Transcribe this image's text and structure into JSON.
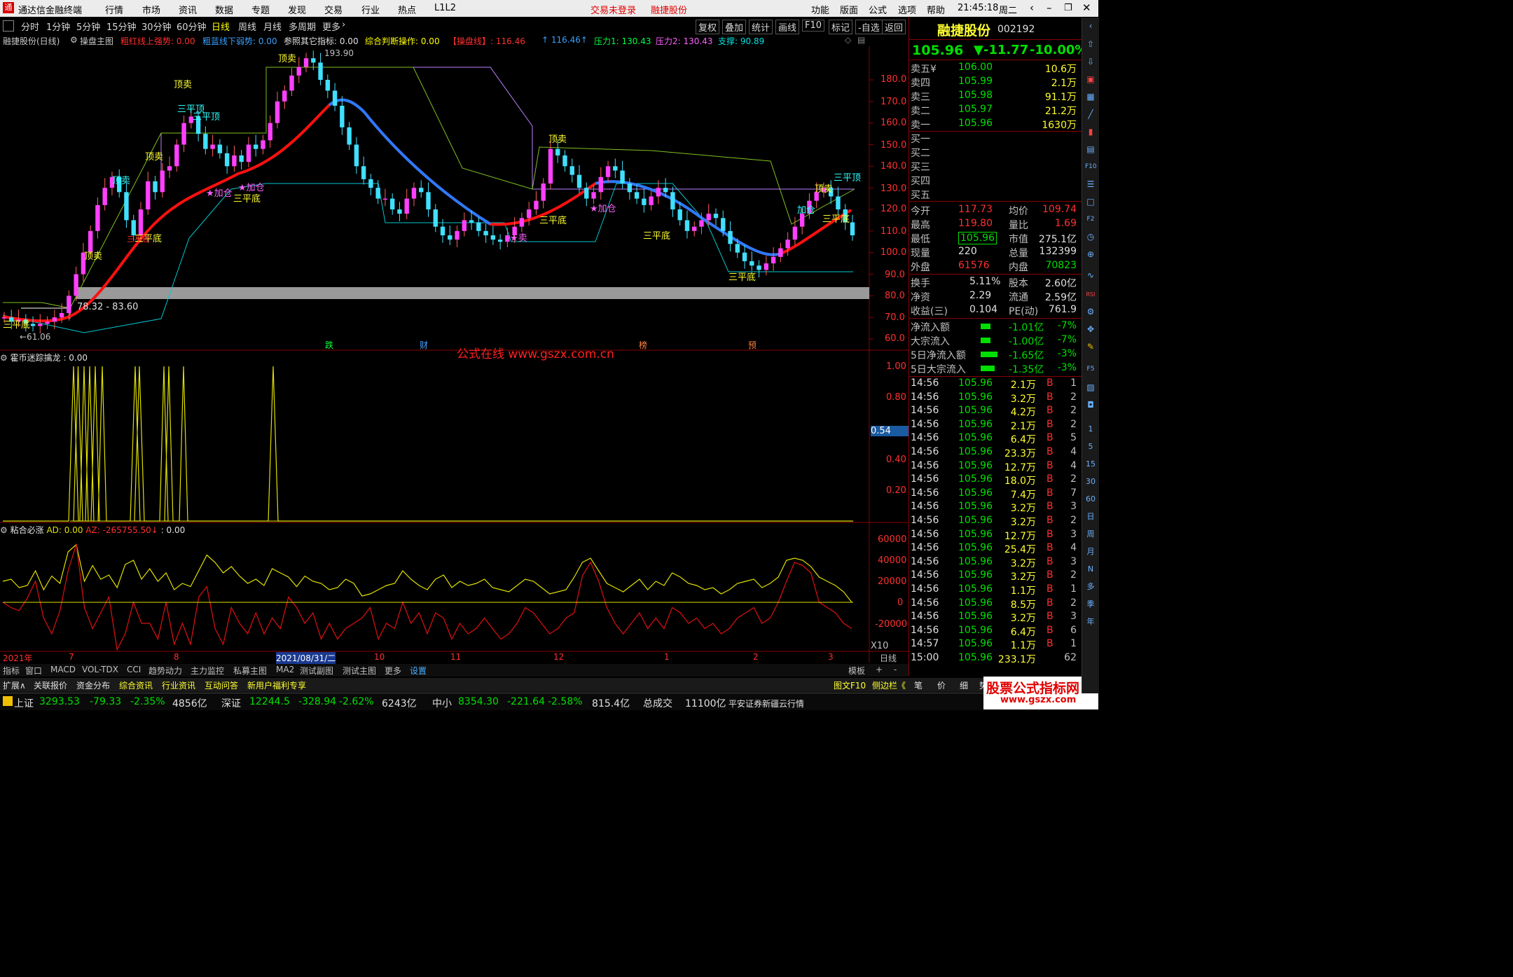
{
  "menubar": {
    "title": "通达信金融终端",
    "items": [
      "行情",
      "市场",
      "资讯",
      "数据",
      "专题",
      "发现",
      "交易",
      "行业",
      "热点",
      "L1L2"
    ],
    "login": "交易未登录",
    "stock": "融捷股份",
    "right": [
      "功能",
      "版面",
      "公式",
      "选项",
      "帮助"
    ],
    "time": "21:45:18",
    "weekday": "周二"
  },
  "toolbar": {
    "periods": [
      "分时",
      "1分钟",
      "5分钟",
      "15分钟",
      "30分钟",
      "60分钟",
      "日线",
      "周线",
      "月线",
      "多周期",
      "更多"
    ],
    "right": [
      "复权",
      "叠加",
      "统计",
      "画线",
      "F10",
      "标记",
      "-自选",
      "返回"
    ]
  },
  "infobar": {
    "name": "融捷股份(日线)",
    "formula": "操盘主图",
    "t1": "粗红线上强势: 0.00",
    "t2": "粗蓝线下弱势: 0.00",
    "t3": "参照其它指标: 0.00",
    "t4": "综合判断操作: 0.00",
    "t5": "【操盘线】: 116.46",
    "t6": "↑ 116.46↑",
    "t7": "压力1: 130.43",
    "t8": "压力2: 130.43",
    "t9": "支撑: 90.89"
  },
  "chart_labels": {
    "high": "193.90",
    "low": "←61.06",
    "zone": "78.32 - 83.60",
    "events": [
      "跌",
      "财",
      "榜",
      "预"
    ],
    "watermark": "公式在线  www.gszx.com.cn",
    "signals": [
      "顶卖",
      "顶卖",
      "三平顶",
      "三平顶",
      "顶卖",
      "顶卖",
      "顶卖",
      "三平底",
      "三平底",
      "★加仓",
      "★加仓",
      "三平底",
      "三平底",
      "三平底",
      "顶卖",
      "顶卖",
      "三平顶",
      "三平底",
      "★加仓",
      "★卖",
      "加仓",
      "三平底",
      "三平底"
    ]
  },
  "indicator1": {
    "name": "霍币迷踪擒龙",
    "value": ": 0.00",
    "current": "0.54"
  },
  "indicator2": {
    "name": "粘合必涨",
    "ad": "AD: 0.00",
    "az": "AZ: -265755.50↓",
    "tail": ": 0.00",
    "x10": "X10"
  },
  "date_axis": [
    "2021年",
    "7",
    "8",
    "2021/08/31/二",
    "10",
    "11",
    "12",
    "1",
    "2",
    "3"
  ],
  "date_axis_right": "日线",
  "price_axis": [
    "180.0",
    "170.0",
    "160.0",
    "150.0",
    "140.0",
    "130.0",
    "120.0",
    "110.0",
    "100.0",
    "90.0",
    "80.0",
    "70.0",
    "60.0"
  ],
  "ind1_axis": [
    "1.00",
    "0.80",
    "0.40",
    "0.20"
  ],
  "ind2_axis": [
    "60000",
    "40000",
    "20000",
    "0",
    "-20000"
  ],
  "bottombar": [
    "指标",
    "窗口",
    "MACD",
    "VOL-TDX",
    "CCI",
    "趋势动力",
    "主力监控",
    "私募主图",
    "MA2",
    "测试副图",
    "测试主图",
    "更多",
    "设置",
    "模板",
    "+",
    "-"
  ],
  "tabs2": [
    "扩展∧",
    "关联报价",
    "资金分布",
    "综合资讯",
    "行业资讯",
    "互动问答",
    "新用户福利专享"
  ],
  "tabs2_right": [
    "图文F10",
    "侧边栏《",
    "笔",
    "价",
    "细",
    "势"
  ],
  "quote": {
    "name": "融捷股份",
    "code": "002192",
    "price": "105.96",
    "change": "▼-11.77",
    "pct": "-10.00%",
    "sell": [
      {
        "label": "卖五¥",
        "price": "106.00",
        "vol": "10.6万"
      },
      {
        "label": "卖四",
        "price": "105.99",
        "vol": "2.1万"
      },
      {
        "label": "卖三",
        "price": "105.98",
        "vol": "91.1万"
      },
      {
        "label": "卖二",
        "price": "105.97",
        "vol": "21.2万"
      },
      {
        "label": "卖一",
        "price": "105.96",
        "vol": "1630万"
      }
    ],
    "buy": [
      "买一",
      "买二",
      "买三",
      "买四",
      "买五"
    ],
    "stats": [
      {
        "a": "今开",
        "b": "117.73",
        "c": "均价",
        "d": "109.74"
      },
      {
        "a": "最高",
        "b": "119.80",
        "c": "量比",
        "d": "1.69"
      },
      {
        "a": "最低",
        "b": "105.96",
        "c": "市值",
        "d": "275.1亿"
      },
      {
        "a": "现量",
        "b": "220",
        "c": "总量",
        "d": "132399"
      },
      {
        "a": "外盘",
        "b": "61576",
        "c": "内盘",
        "d": "70823"
      }
    ],
    "stats2": [
      {
        "a": "换手",
        "b": "5.11%",
        "c": "股本",
        "d": "2.60亿"
      },
      {
        "a": "净资",
        "b": "2.29",
        "c": "流通",
        "d": "2.59亿"
      },
      {
        "a": "收益(三)",
        "b": "0.104",
        "c": "PE(动)",
        "d": "761.9"
      }
    ],
    "flows": [
      {
        "a": "净流入额",
        "b": "-1.01亿",
        "c": "-7%"
      },
      {
        "a": "大宗流入",
        "b": "-1.00亿",
        "c": "-7%"
      },
      {
        "a": "5日净流入额",
        "b": "-1.65亿",
        "c": "-3%"
      },
      {
        "a": "5日大宗流入",
        "b": "-1.35亿",
        "c": "-3%"
      }
    ],
    "ticks": [
      [
        "14:56",
        "105.96",
        "2.1万",
        "B",
        "1"
      ],
      [
        "14:56",
        "105.96",
        "3.2万",
        "B",
        "2"
      ],
      [
        "14:56",
        "105.96",
        "4.2万",
        "B",
        "2"
      ],
      [
        "14:56",
        "105.96",
        "2.1万",
        "B",
        "2"
      ],
      [
        "14:56",
        "105.96",
        "6.4万",
        "B",
        "5"
      ],
      [
        "14:56",
        "105.96",
        "23.3万",
        "B",
        "4"
      ],
      [
        "14:56",
        "105.96",
        "12.7万",
        "B",
        "4"
      ],
      [
        "14:56",
        "105.96",
        "18.0万",
        "B",
        "2"
      ],
      [
        "14:56",
        "105.96",
        "7.4万",
        "B",
        "7"
      ],
      [
        "14:56",
        "105.96",
        "3.2万",
        "B",
        "3"
      ],
      [
        "14:56",
        "105.96",
        "3.2万",
        "B",
        "2"
      ],
      [
        "14:56",
        "105.96",
        "12.7万",
        "B",
        "3"
      ],
      [
        "14:56",
        "105.96",
        "25.4万",
        "B",
        "4"
      ],
      [
        "14:56",
        "105.96",
        "3.2万",
        "B",
        "3"
      ],
      [
        "14:56",
        "105.96",
        "3.2万",
        "B",
        "2"
      ],
      [
        "14:56",
        "105.96",
        "1.1万",
        "B",
        "1"
      ],
      [
        "14:56",
        "105.96",
        "8.5万",
        "B",
        "2"
      ],
      [
        "14:56",
        "105.96",
        "3.2万",
        "B",
        "3"
      ],
      [
        "14:56",
        "105.96",
        "6.4万",
        "B",
        "6"
      ],
      [
        "14:57",
        "105.96",
        "1.1万",
        "B",
        "1"
      ],
      [
        "15:00",
        "105.96",
        "233.1万",
        "",
        "62"
      ]
    ]
  },
  "sidebar_labels": [
    "1",
    "5",
    "15",
    "30",
    "60",
    "日",
    "周",
    "月",
    "N",
    "多",
    "季",
    "年"
  ],
  "status": {
    "sh_label": "上证",
    "sh": "3293.53",
    "sh_chg": "-79.33",
    "sh_pct": "-2.35%",
    "sh_amt": "4856亿",
    "sz_label": "深证",
    "sz": "12244.5",
    "sz_chg": "-328.94",
    "sz_pct": "-2.62%",
    "sz_amt": "6243亿",
    "zx_label": "中小",
    "zx": "8354.30",
    "zx_chg": "-221.64",
    "zx_pct": "-2.58%",
    "zx_amt": "815.4亿",
    "total_label": "总成交",
    "total": "11100亿",
    "broker": "平安证券新疆云行情",
    "brand": "股票公式指标网",
    "brand_url": "www.gszx.com"
  }
}
